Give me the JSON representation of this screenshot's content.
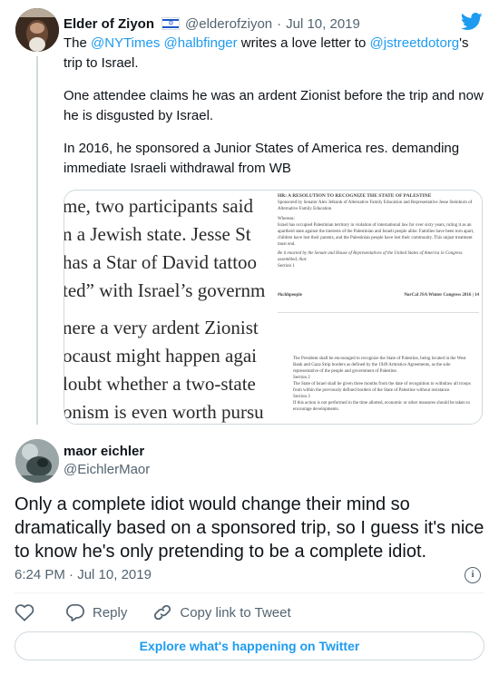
{
  "quoted": {
    "display_name": "Elder of Ziyon",
    "flag_icon": "israel-flag-icon",
    "handle": "@elderofziyon",
    "separator": "·",
    "date": "Jul 10, 2019",
    "text_para1_pre": "The ",
    "mention1": "@NYTimes",
    "mention2": "@halbfinger",
    "text_para1_mid": " writes a love letter to ",
    "mention3": "@jstreetdotorg",
    "text_para1_post": "'s trip to Israel.",
    "text_para2": "One attendee claims he was an ardent Zionist before the trip and now he is disgusted by Israel.",
    "text_para3": "In 2016, he sponsored a Junior States of America res. demanding immediate Israeli withdrawal from WB",
    "media": {
      "article_lines": [
        "me, two participants said",
        "n a Jewish state. Jesse St",
        "has a Star of David tattoo",
        "ted” with Israel’s governm",
        "nere a very ardent Zionist",
        "ocaust might happen agai",
        "loubt whether a two-state",
        "onism is even worth pursu"
      ],
      "doc_title": "HR: A RESOLUTION TO RECOGNIZE THE STATE OF PALESTINE",
      "doc_sponsors": "Sponsored by Senator Alex Jelkunk of Alternative Family Education and Representative Jesse Steinhurn of Alternative Family Education",
      "doc_whereas_label": "Whereas:",
      "doc_whereas_text": "Israel has occupied Palestinian territory in violation of international law for over sixty years, ruling it as an apartheid state against the interests of the Palestinian and Israeli people alike. Families have been torn apart, children have lost their parents, and the Palestinian people have lost their community. This unjust treatment must end.",
      "doc_enacted": "Be it enacted by the Senate and House of Representatives of the United States of America in Congress assembled, that:",
      "doc_section1": "Section 1",
      "doc_footer_left": "#kchhpeople",
      "doc_footer_right": "NorCal JSA Winter Congress 2016 | 14",
      "doc_body1": "The President shall be encouraged to recognize the State of Palestine, being located in the West Bank and Gaza Strip borders as defined by the 1949 Armistice Agreements, as the sole representative of the people and government of Palestine.",
      "doc_section2": "Section 2",
      "doc_body2": "The State of Israel shall be given three months from the date of recognition to withdraw all troops from within the previously defined borders of the State of Palestine without resistance.",
      "doc_section3": "Section 3",
      "doc_body3": "If this action is not performed in the time allotted, economic or other measures should be taken to encourage developments."
    }
  },
  "tweet": {
    "display_name": "maor eichler",
    "handle": "@EichlerMaor",
    "text": "Only a complete idiot would change their mind so dramatically based on a sponsored trip, so I guess it's nice to know he's only pretending to be a complete idiot.",
    "time": "6:24 PM",
    "separator": "·",
    "date": "Jul 10, 2019",
    "info_glyph": "i"
  },
  "actions": {
    "like_icon": "heart-icon",
    "reply_icon": "reply-icon",
    "reply_label": "Reply",
    "copy_icon": "link-icon",
    "copy_label": "Copy link to Tweet"
  },
  "footer": {
    "explore_label": "Explore what's happening on Twitter"
  },
  "colors": {
    "accent": "#1d9bf0",
    "text": "#0f1419",
    "muted": "#536471",
    "border": "#cfd9de"
  }
}
